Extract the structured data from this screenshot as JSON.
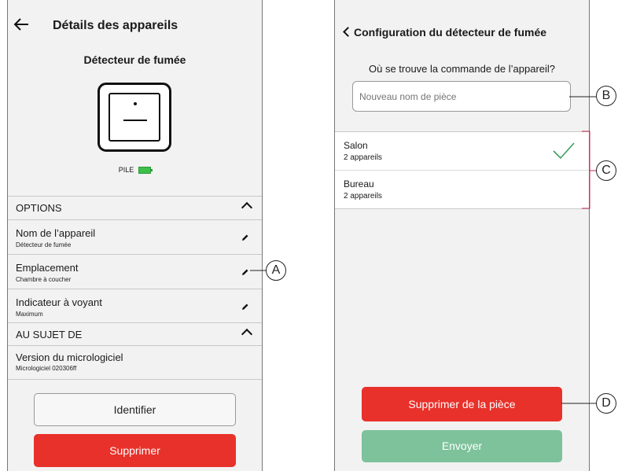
{
  "left": {
    "header": {
      "back_icon": "arrow-left-icon",
      "title": "Détails des appareils"
    },
    "device_name": "Détecteur de fumée",
    "battery_label": "PILE",
    "battery_color": "#3dbf4a",
    "options": {
      "header": "OPTIONS",
      "items": [
        {
          "label": "Nom de l’appareil",
          "value": "Détecteur de fumée"
        },
        {
          "label": "Emplacement",
          "value": "Chambre à coucher"
        },
        {
          "label": "Indicateur à voyant",
          "value": "Maximum"
        }
      ]
    },
    "about": {
      "header": "AU SUJET DE",
      "items": [
        {
          "label": "Version du micrologiciel",
          "value": "Micrologiciel 020306ff"
        }
      ]
    },
    "identify_button": "Identifier",
    "delete_button": "Supprimer"
  },
  "right": {
    "header": {
      "title": "Configuration du détecteur de fumée"
    },
    "question": "Où se trouve la commande de l’appareil?",
    "room_input": {
      "placeholder": "Nouveau nom de pièce",
      "value": ""
    },
    "rooms": [
      {
        "name": "Salon",
        "count": "2 appareils",
        "selected": true
      },
      {
        "name": "Bureau",
        "count": "2 appareils",
        "selected": false
      }
    ],
    "remove_button": "Supprimer de la pièce",
    "send_button": "Envoyer"
  },
  "callouts": [
    "A",
    "B",
    "C",
    "D"
  ],
  "colors": {
    "accent_red": "#e8312a",
    "accent_green": "#7dc29b",
    "check_green": "#3a9e5f",
    "background": "#f2f2f2"
  }
}
